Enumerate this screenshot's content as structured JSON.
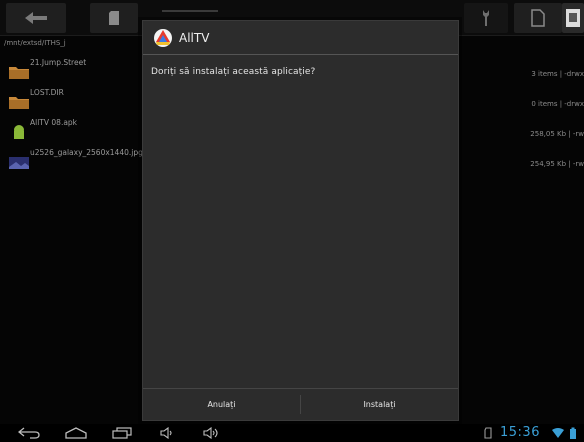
{
  "path": "/mnt/extsd/ITHS_j",
  "files": [
    {
      "name": "21.Jump.Street",
      "meta": "3 items | -drwx",
      "icon": "folder-icon"
    },
    {
      "name": "LOST.DIR",
      "meta": "0 items | -drwx",
      "icon": "folder-icon"
    },
    {
      "name": "AllTV 08.apk",
      "meta": "258,05 Kb | -rw",
      "icon": "android-apk-icon"
    },
    {
      "name": "u2526_galaxy_2560x1440.jpg",
      "meta": "254,95 Kb | -rw",
      "icon": "image-icon"
    }
  ],
  "dialog": {
    "app_name": "AllTV",
    "message": "Doriți să instalați această aplicație?",
    "cancel_label": "Anulați",
    "install_label": "Instalați"
  },
  "status": {
    "time": "15:36"
  },
  "colors": {
    "clock": "#3a9fd6",
    "folder": "#c8893a",
    "android": "#8ab838"
  }
}
